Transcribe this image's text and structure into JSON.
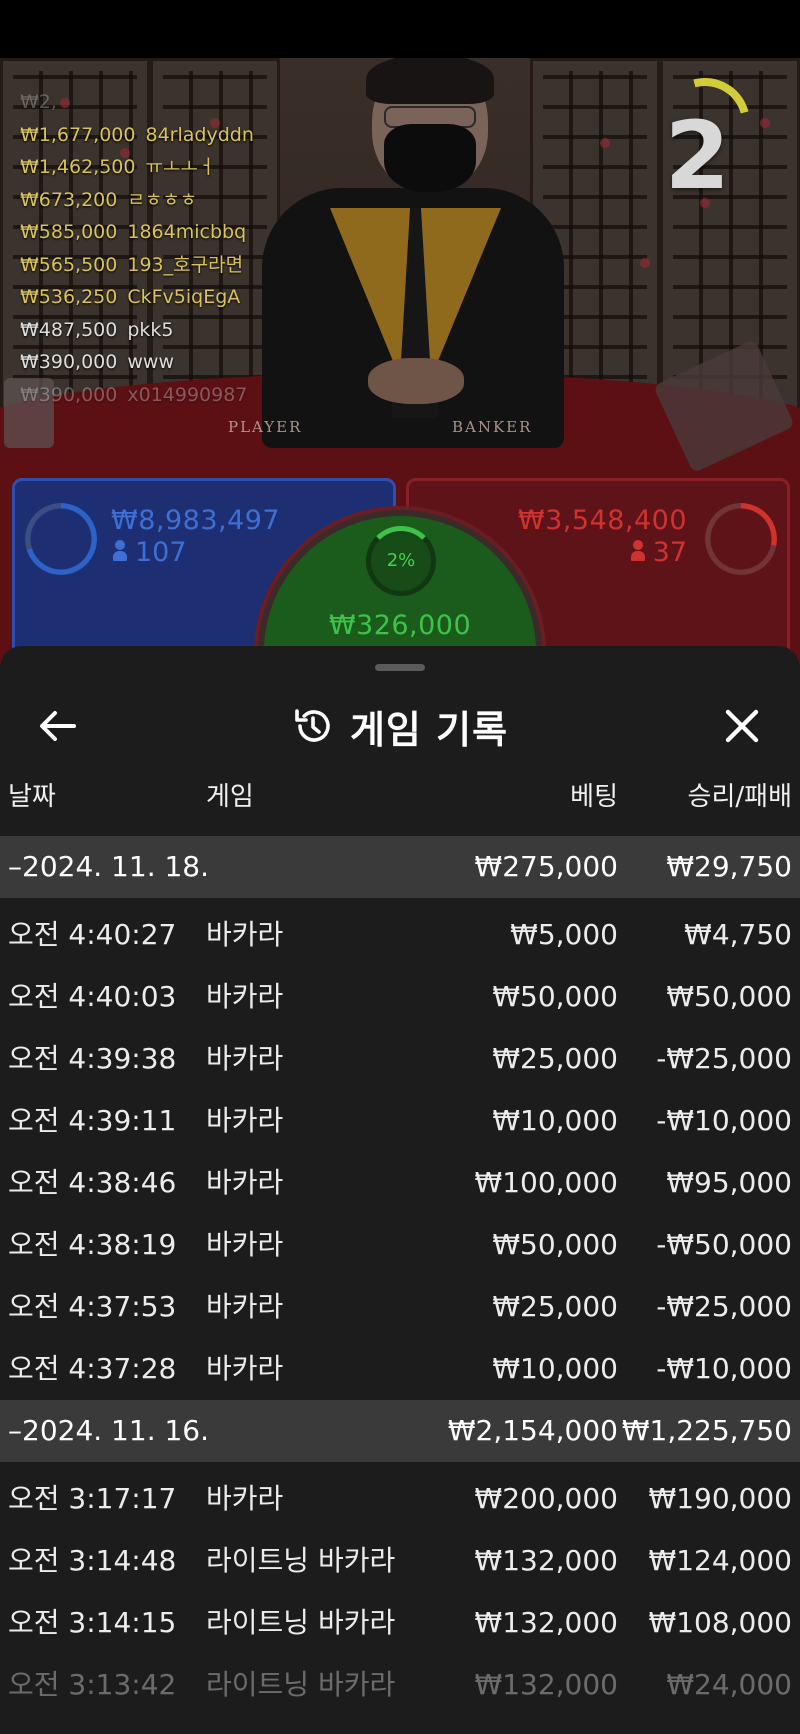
{
  "stream": {
    "round_number": "2",
    "table_labels": {
      "player": "PLAYER",
      "banker": "BANKER"
    },
    "leaderboard": [
      {
        "amount": "₩2,",
        "name": "",
        "tone": "white"
      },
      {
        "amount": "₩1,677,000",
        "name": "84rladyddn",
        "tone": "gold"
      },
      {
        "amount": "₩1,462,500",
        "name": "ㅠㅗㅗㅓ",
        "tone": "gold"
      },
      {
        "amount": "₩673,200",
        "name": "ㄹㅎㅎㅎ",
        "tone": "gold"
      },
      {
        "amount": "₩585,000",
        "name": "1864micbbq",
        "tone": "gold"
      },
      {
        "amount": "₩565,500",
        "name": "193_호구라면",
        "tone": "gold"
      },
      {
        "amount": "₩536,250",
        "name": "CkFv5iqEgA",
        "tone": "gold"
      },
      {
        "amount": "₩487,500",
        "name": "pkk5",
        "tone": "white"
      },
      {
        "amount": "₩390,000",
        "name": "www",
        "tone": "white"
      },
      {
        "amount": "₩390,000",
        "name": "x014990987",
        "tone": "white"
      }
    ],
    "player_bet": {
      "percent": "70%",
      "percent_value": 0.7,
      "amount": "₩8,983,497",
      "players": "107",
      "color": "#2d63c8"
    },
    "banker_bet": {
      "percent": "28%",
      "percent_value": 0.28,
      "amount": "₩3,548,400",
      "players": "37",
      "color": "#d0322e"
    },
    "tie_bet": {
      "percent": "2%",
      "percent_value": 0.02,
      "amount": "₩326,000",
      "color": "#3fc24a"
    }
  },
  "sheet": {
    "title": "게임 기록",
    "icons": {
      "back": "arrow-left-icon",
      "history": "history-clock-icon",
      "close": "close-x-icon"
    },
    "columns": {
      "date": "날짜",
      "game": "게임",
      "bet": "베팅",
      "win_loss": "승리/패배"
    },
    "groups": [
      {
        "date": "–2024. 11. 18.",
        "bet_total": "₩275,000",
        "win_total": "₩29,750",
        "rows": [
          {
            "time": "오전 4:40:27",
            "game": "바카라",
            "bet": "₩5,000",
            "result": "₩4,750"
          },
          {
            "time": "오전 4:40:03",
            "game": "바카라",
            "bet": "₩50,000",
            "result": "₩50,000"
          },
          {
            "time": "오전 4:39:38",
            "game": "바카라",
            "bet": "₩25,000",
            "result": "-₩25,000"
          },
          {
            "time": "오전 4:39:11",
            "game": "바카라",
            "bet": "₩10,000",
            "result": "-₩10,000"
          },
          {
            "time": "오전 4:38:46",
            "game": "바카라",
            "bet": "₩100,000",
            "result": "₩95,000"
          },
          {
            "time": "오전 4:38:19",
            "game": "바카라",
            "bet": "₩50,000",
            "result": "-₩50,000"
          },
          {
            "time": "오전 4:37:53",
            "game": "바카라",
            "bet": "₩25,000",
            "result": "-₩25,000"
          },
          {
            "time": "오전 4:37:28",
            "game": "바카라",
            "bet": "₩10,000",
            "result": "-₩10,000"
          }
        ]
      },
      {
        "date": "–2024. 11. 16.",
        "bet_total": "₩2,154,000",
        "win_total": "₩1,225,750",
        "rows": [
          {
            "time": "오전 3:17:17",
            "game": "바카라",
            "bet": "₩200,000",
            "result": "₩190,000"
          },
          {
            "time": "오전 3:14:48",
            "game": "라이트닝 바카라",
            "bet": "₩132,000",
            "result": "₩124,000"
          },
          {
            "time": "오전 3:14:15",
            "game": "라이트닝 바카라",
            "bet": "₩132,000",
            "result": "₩108,000"
          },
          {
            "time": "오전 3:13:42",
            "game": "라이트닝 바카라",
            "bet": "₩132,000",
            "result": "₩24,000"
          }
        ]
      }
    ]
  }
}
